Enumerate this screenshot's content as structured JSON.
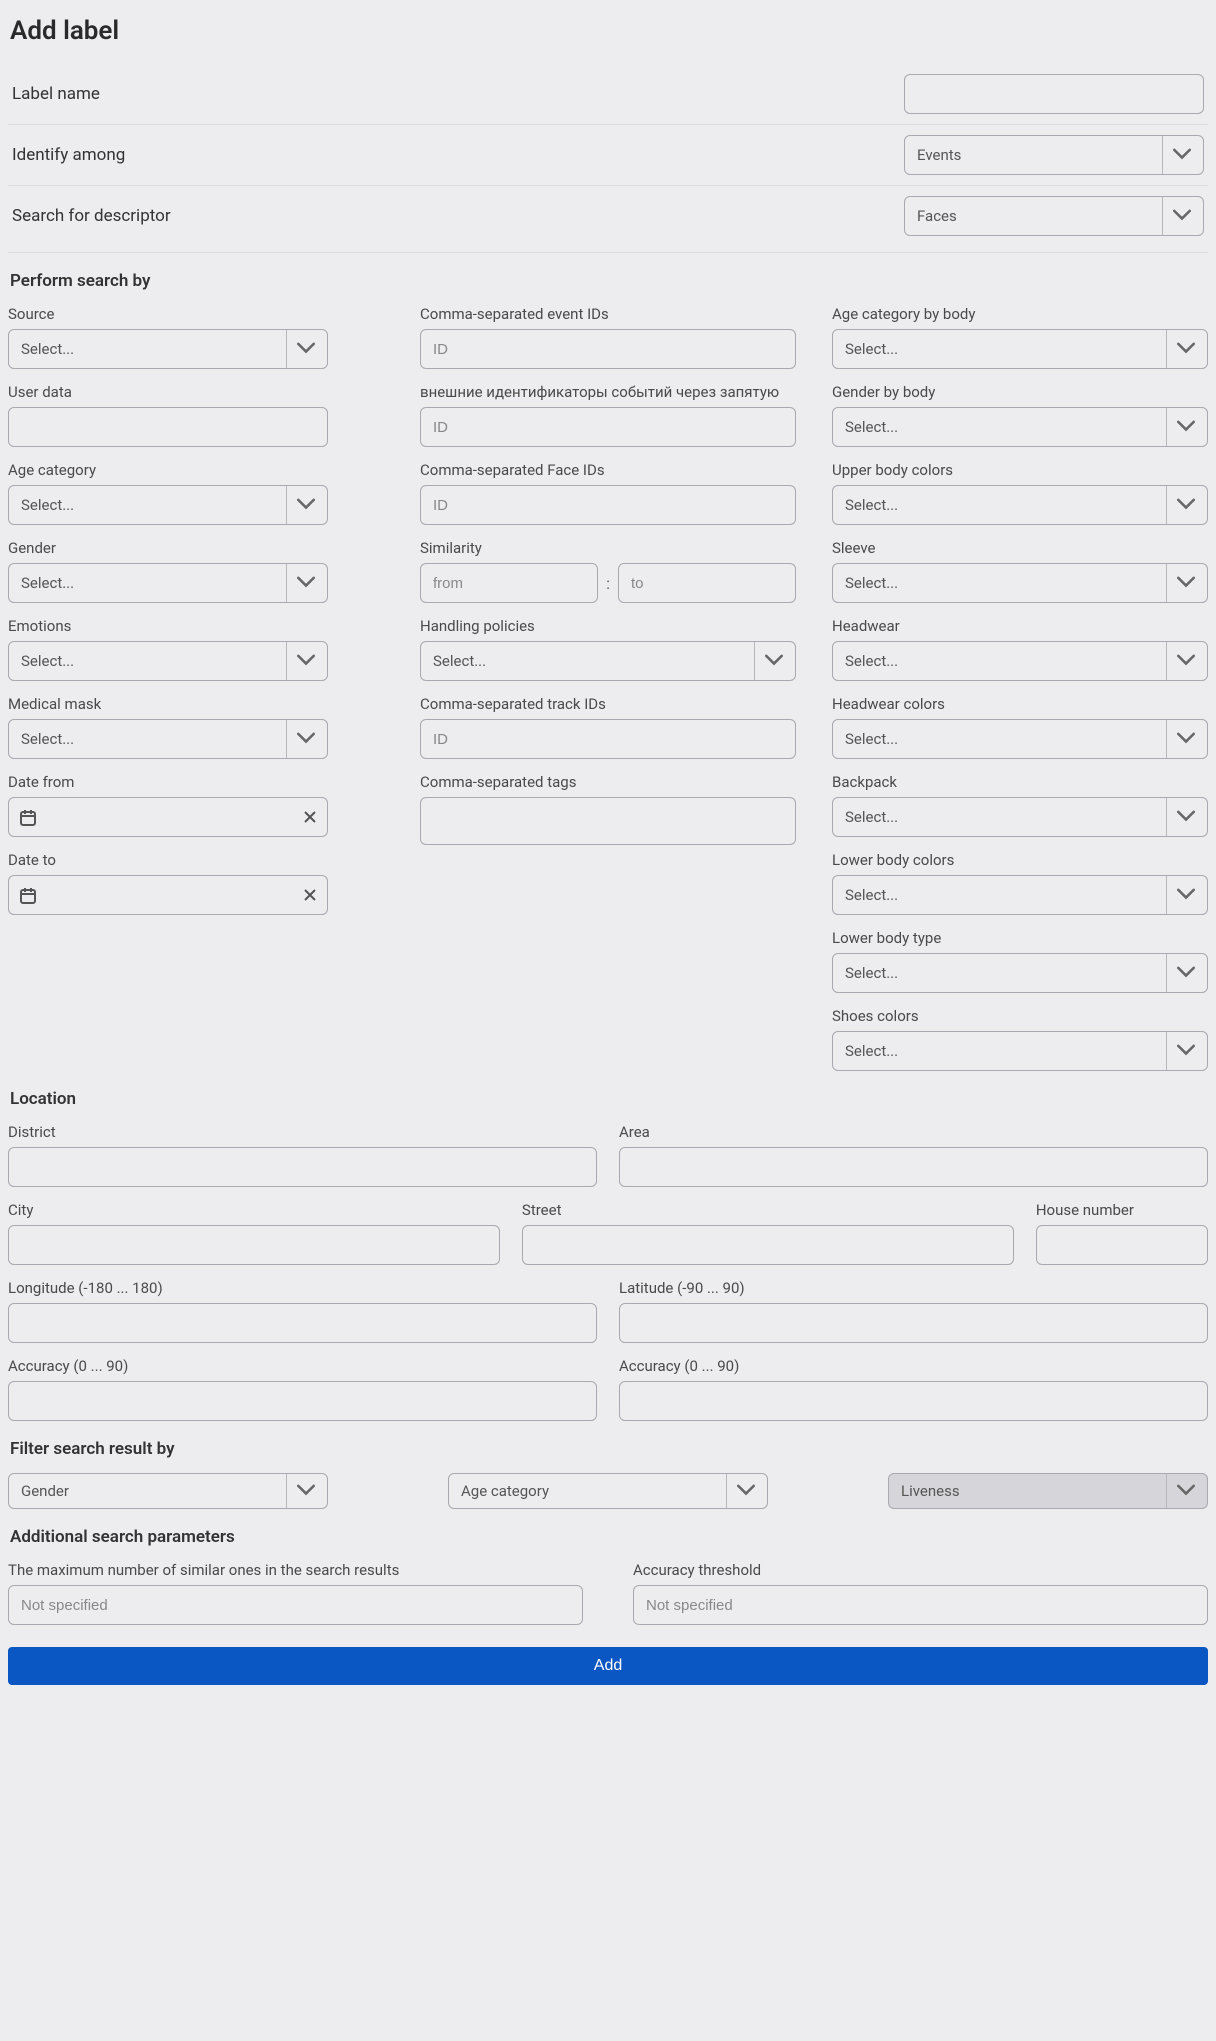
{
  "title": "Add label",
  "topRows": {
    "labelName": "Label name",
    "identifyAmong": {
      "label": "Identify among",
      "value": "Events"
    },
    "searchDescriptor": {
      "label": "Search for descriptor",
      "value": "Faces"
    }
  },
  "performSearch": {
    "heading": "Perform search by",
    "col1": {
      "source": {
        "label": "Source",
        "placeholder": "Select..."
      },
      "userData": {
        "label": "User data"
      },
      "ageCategory": {
        "label": "Age category",
        "placeholder": "Select..."
      },
      "gender": {
        "label": "Gender",
        "placeholder": "Select..."
      },
      "emotions": {
        "label": "Emotions",
        "placeholder": "Select..."
      },
      "medicalMask": {
        "label": "Medical mask",
        "placeholder": "Select..."
      },
      "dateFrom": {
        "label": "Date from"
      },
      "dateTo": {
        "label": "Date to"
      }
    },
    "col2": {
      "eventIds": {
        "label": "Comma-separated event IDs",
        "placeholder": "ID"
      },
      "extIds": {
        "label": "внешние идентификаторы событий через запятую",
        "placeholder": "ID"
      },
      "faceIds": {
        "label": "Comma-separated Face IDs",
        "placeholder": "ID"
      },
      "similarity": {
        "label": "Similarity",
        "fromPlaceholder": "from",
        "toPlaceholder": "to",
        "sep": ":"
      },
      "handlingPolicies": {
        "label": "Handling policies",
        "placeholder": "Select..."
      },
      "trackIds": {
        "label": "Comma-separated track IDs",
        "placeholder": "ID"
      },
      "tags": {
        "label": "Comma-separated tags"
      }
    },
    "col3": {
      "ageBody": {
        "label": "Age category by body",
        "placeholder": "Select..."
      },
      "genderBody": {
        "label": "Gender by body",
        "placeholder": "Select..."
      },
      "upperColors": {
        "label": "Upper body colors",
        "placeholder": "Select..."
      },
      "sleeve": {
        "label": "Sleeve",
        "placeholder": "Select..."
      },
      "headwear": {
        "label": "Headwear",
        "placeholder": "Select..."
      },
      "headwearColors": {
        "label": "Headwear colors",
        "placeholder": "Select..."
      },
      "backpack": {
        "label": "Backpack",
        "placeholder": "Select..."
      },
      "lowerColors": {
        "label": "Lower body colors",
        "placeholder": "Select..."
      },
      "lowerType": {
        "label": "Lower body type",
        "placeholder": "Select..."
      },
      "shoesColors": {
        "label": "Shoes colors",
        "placeholder": "Select..."
      }
    }
  },
  "location": {
    "heading": "Location",
    "district": "District",
    "area": "Area",
    "city": "City",
    "street": "Street",
    "house": "House number",
    "longitude": "Longitude (-180 ... 180)",
    "latitude": "Latitude (-90 ... 90)",
    "accuracyLon": "Accuracy (0 ... 90)",
    "accuracyLat": "Accuracy (0 ... 90)"
  },
  "filter": {
    "heading": "Filter search result by",
    "gender": "Gender",
    "ageCategory": "Age category",
    "liveness": "Liveness"
  },
  "additional": {
    "heading": "Additional search parameters",
    "maxSimilar": {
      "label": "The maximum number of similar ones in the search results",
      "placeholder": "Not specified"
    },
    "threshold": {
      "label": "Accuracy threshold",
      "placeholder": "Not specified"
    }
  },
  "addButton": "Add"
}
